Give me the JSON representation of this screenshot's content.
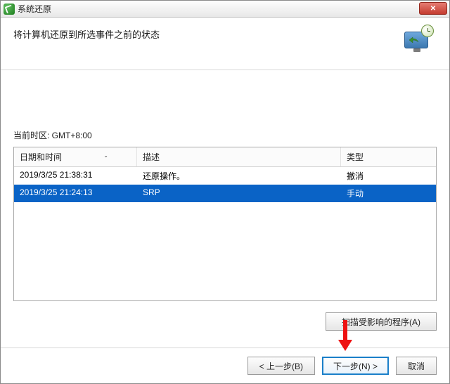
{
  "window": {
    "title": "系统还原"
  },
  "header": {
    "instruction": "将计算机还原到所选事件之前的状态"
  },
  "timezone_label": "当前时区: GMT+8:00",
  "grid": {
    "headers": {
      "date": "日期和时间",
      "desc": "描述",
      "type": "类型"
    },
    "rows": [
      {
        "date": "2019/3/25 21:38:31",
        "desc": "还原操作。",
        "type": "撤消",
        "selected": false
      },
      {
        "date": "2019/3/25 21:24:13",
        "desc": "SRP",
        "type": "手动",
        "selected": true
      }
    ]
  },
  "buttons": {
    "scan": "扫描受影响的程序(A)",
    "back": "< 上一步(B)",
    "next": "下一步(N) >",
    "cancel": "取消"
  }
}
